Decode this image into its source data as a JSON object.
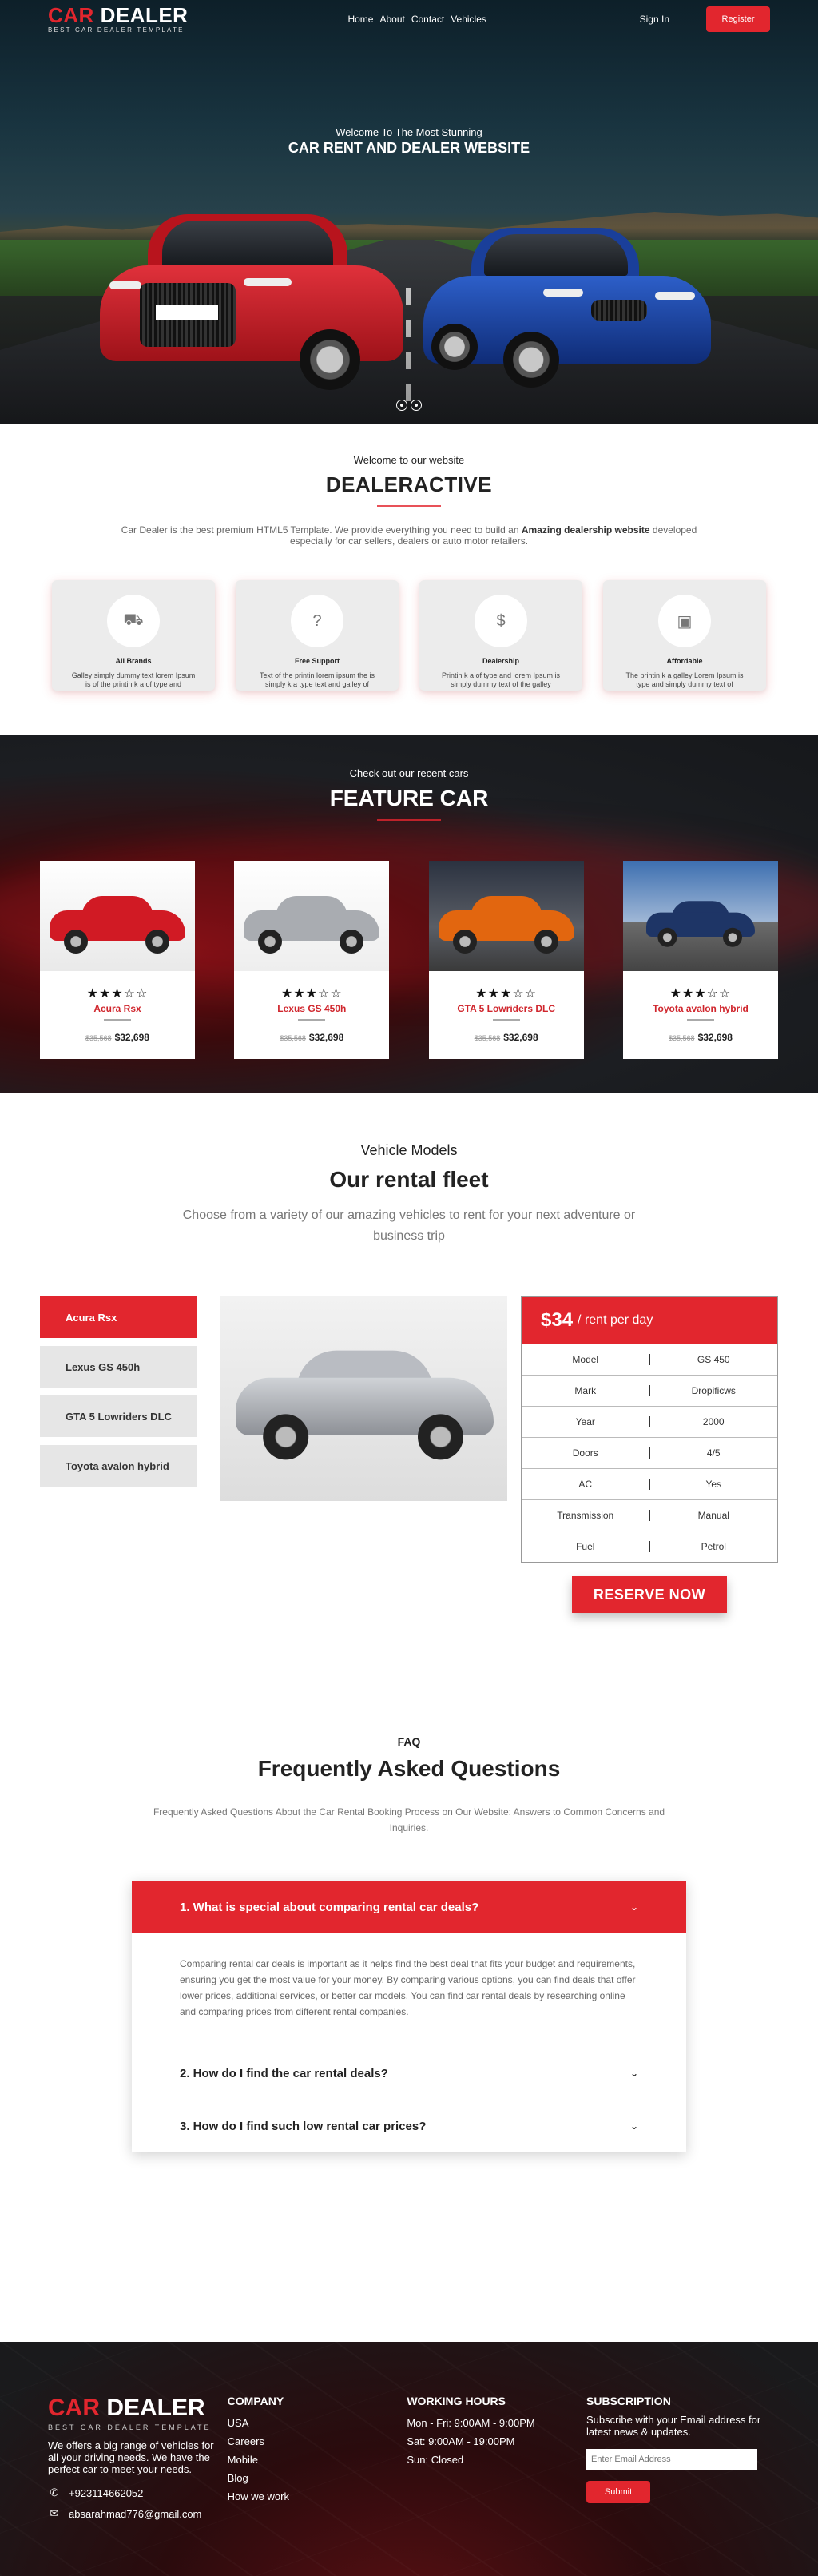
{
  "nav": {
    "logo_red": "CAR",
    "logo_white": " DEALER",
    "logo_tag": "BEST CAR DEALER TEMPLATE",
    "links": [
      "Home",
      "About",
      "Contact",
      "Vehicles"
    ],
    "signin": "Sign In",
    "register": "Register"
  },
  "hero": {
    "eyebrow": "Welcome To The Most Stunning",
    "title": "CAR RENT AND DEALER WEBSITE"
  },
  "welcome": {
    "eyebrow": "Welcome to our website",
    "title": "DEALERACTIVE",
    "text_before": "Car Dealer is the best premium HTML5 Template. We provide everything you need to build an ",
    "text_bold": "Amazing dealership website",
    "text_after": " developed especially for car sellers, dealers or auto motor retailers.",
    "features": [
      {
        "icon": "car-icon",
        "glyph": "⛟",
        "title": "All Brands",
        "text": "Galley simply dummy text lorem Ipsum is of the printin k a of type and"
      },
      {
        "icon": "question-icon",
        "glyph": "?",
        "title": "Free Support",
        "text": "Text of the printin lorem ipsum the is simply k a type text and galley of"
      },
      {
        "icon": "dollar-icon",
        "glyph": "$",
        "title": "Dealership",
        "text": "Printin k a of type and lorem Ipsum is simply dummy text of the galley"
      },
      {
        "icon": "wallet-icon",
        "glyph": "▣",
        "title": "Affordable",
        "text": "The printin k a galley Lorem Ipsum is type and simply dummy text of"
      }
    ]
  },
  "feature_car": {
    "eyebrow": "Check out our recent cars",
    "title": "FEATURE CAR",
    "cars": [
      {
        "name": "Acura Rsx",
        "old_price": "$35,568",
        "price": "$32,698",
        "stars": "★★★☆☆",
        "color": "#d11a24"
      },
      {
        "name": "Lexus GS 450h",
        "old_price": "$35,568",
        "price": "$32,698",
        "stars": "★★★☆☆",
        "color": "#a9acb1"
      },
      {
        "name": "GTA 5 Lowriders DLC",
        "old_price": "$35,568",
        "price": "$32,698",
        "stars": "★★★☆☆",
        "color": "#e2660f"
      },
      {
        "name": "Toyota avalon hybrid",
        "old_price": "$35,568",
        "price": "$32,698",
        "stars": "★★★☆☆",
        "color": "#1e3566"
      }
    ]
  },
  "fleet": {
    "eyebrow": "Vehicle Models",
    "title": "Our rental fleet",
    "subtitle": "Choose from a variety of our amazing vehicles to rent for your next adventure or business trip",
    "models": [
      "Acura Rsx",
      "Lexus GS 450h",
      "GTA 5 Lowriders DLC",
      "Toyota avalon hybrid"
    ],
    "price": "$34",
    "per": "/ rent per day",
    "specs": [
      {
        "label": "Model",
        "value": "GS 450"
      },
      {
        "label": "Mark",
        "value": "Dropificws"
      },
      {
        "label": "Year",
        "value": "2000"
      },
      {
        "label": "Doors",
        "value": "4/5"
      },
      {
        "label": "AC",
        "value": "Yes"
      },
      {
        "label": "Transmission",
        "value": "Manual"
      },
      {
        "label": "Fuel",
        "value": "Petrol"
      }
    ],
    "reserve": "RESERVE NOW"
  },
  "faq": {
    "eyebrow": "FAQ",
    "title": "Frequently Asked Questions",
    "subtitle": "Frequently Asked Questions About the Car Rental Booking Process on Our Website: Answers to Common Concerns and Inquiries.",
    "items": [
      {
        "q": "1. What is special about comparing rental car deals?",
        "a": "Comparing rental car deals is important as it helps find the best deal that fits your budget and requirements, ensuring you get the most value for your money. By comparing various options, you can find deals that offer lower prices, additional services, or better car models. You can find car rental deals by researching online and comparing prices from different rental companies."
      },
      {
        "q": "2. How do I find the car rental deals?",
        "a": ""
      },
      {
        "q": "3. How do I find such low rental car prices?",
        "a": ""
      }
    ]
  },
  "footer": {
    "logo_red": "CAR",
    "logo_white": " DEALER",
    "logo_tag": "BEST CAR DEALER TEMPLATE",
    "about": "We offers a big range of vehicles for all your driving needs. We have the perfect car to meet your needs.",
    "phone": "+923114662052",
    "email": "absarahmad776@gmail.com",
    "company_title": "COMPANY",
    "company_links": [
      "USA",
      "Careers",
      "Mobile",
      "Blog",
      "How we work"
    ],
    "hours_title": "WORKING HOURS",
    "hours": [
      "Mon - Fri: 9:00AM - 9:00PM",
      "Sat: 9:00AM - 19:00PM",
      "Sun: Closed"
    ],
    "sub_title": "SUBSCRIPTION",
    "sub_text": "Subscribe with your Email address for latest news & updates.",
    "email_placeholder": "Enter Email Address",
    "submit": "Submit"
  }
}
